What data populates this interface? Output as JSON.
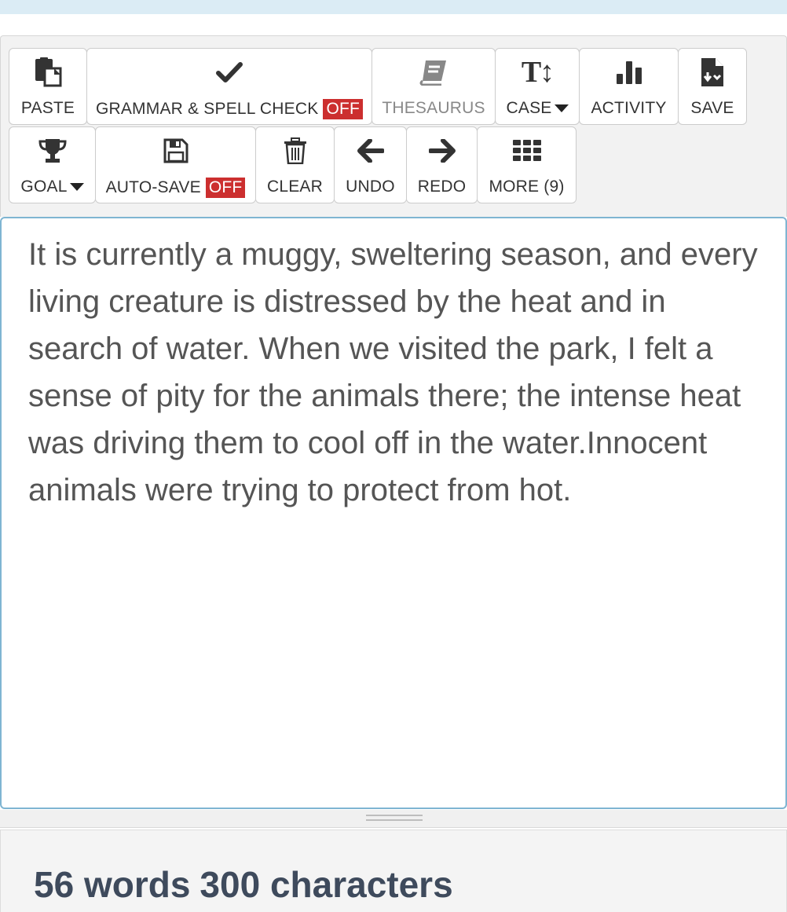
{
  "toolbar": {
    "paste_label": "PASTE",
    "grammar_label": "GRAMMAR & SPELL CHECK",
    "grammar_state": "OFF",
    "thesaurus_label": "THESAURUS",
    "case_label": "CASE",
    "activity_label": "ACTIVITY",
    "save_label": "SAVE",
    "goal_label": "GOAL",
    "autosave_label": "AUTO-SAVE",
    "autosave_state": "OFF",
    "clear_label": "CLEAR",
    "undo_label": "UNDO",
    "redo_label": "REDO",
    "more_label": "MORE (9)",
    "case_icon_text": "T↕"
  },
  "editor": {
    "text": "It is currently a muggy, sweltering season, and every living creature is distressed by the heat and in search of water. When we visited the park, I felt a sense of pity for the animals there; the intense heat was driving them to cool off in the water.Innocent animals were trying to protect from hot."
  },
  "stats": {
    "words": "56 words",
    "characters": "300 characters"
  },
  "colors": {
    "off_badge": "#cc2f2f",
    "editor_border": "#7fb5d2",
    "top_bar": "#dbecf5",
    "stats_text": "#3e4a5c"
  }
}
